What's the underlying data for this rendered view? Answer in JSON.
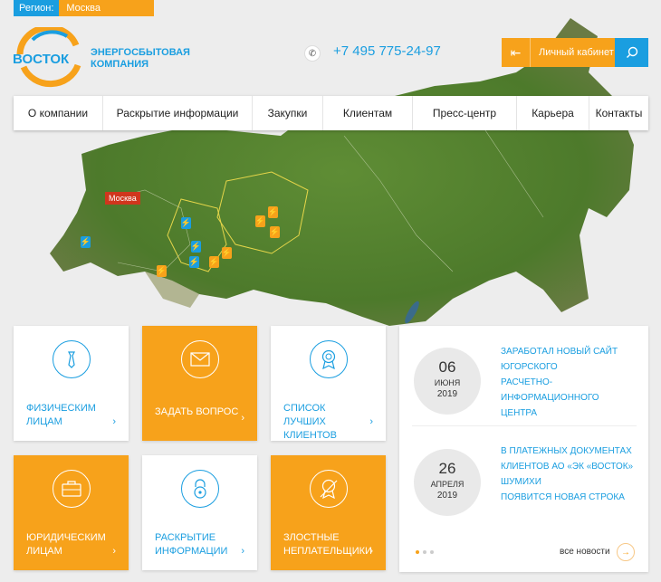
{
  "region": {
    "label": "Регион:",
    "value": "Москва"
  },
  "brand": {
    "logo_text": "ВОСТОК",
    "line1": "Энергосбытовая",
    "line2": "компания"
  },
  "header": {
    "phone": "+7 495 775-24-97",
    "cabinet_label": "Личный кабинет"
  },
  "nav": {
    "items": [
      {
        "label": "О компании"
      },
      {
        "label": "Раскрытие информации"
      },
      {
        "label": "Закупки"
      },
      {
        "label": "Клиентам"
      },
      {
        "label": "Пресс-центр"
      },
      {
        "label": "Карьера"
      },
      {
        "label": "Контакты"
      }
    ]
  },
  "map": {
    "city_label": "Москва"
  },
  "tiles": [
    {
      "line1": "Физическим",
      "line2": "лицам",
      "icon": "tie-icon"
    },
    {
      "line1": "Задать вопрос",
      "line2": "",
      "icon": "envelope-icon"
    },
    {
      "line1": "Список лучших",
      "line2": "клиентов",
      "icon": "award-icon"
    },
    {
      "line1": "Юридическим",
      "line2": "лицам",
      "icon": "briefcase-icon"
    },
    {
      "line1": "Раскрытие",
      "line2": "информации",
      "icon": "lock-icon"
    },
    {
      "line1": "Злостные",
      "line2": "неплательщики",
      "icon": "crossed-award-icon"
    }
  ],
  "news": {
    "items": [
      {
        "day": "06",
        "month": "июня",
        "year": "2019",
        "l1": "Заработал новый сайт Югорского",
        "l2": "расчетно-информационного",
        "l3": "центра"
      },
      {
        "day": "26",
        "month": "апреля",
        "year": "2019",
        "l1": "В платежных документах",
        "l2": "клиентов АО «ЭК «Восток» Шумихи",
        "l3": "появится новая строка"
      }
    ],
    "all_label": "все новости"
  },
  "colors": {
    "orange": "#f7a21b",
    "blue": "#1a9ee0"
  }
}
